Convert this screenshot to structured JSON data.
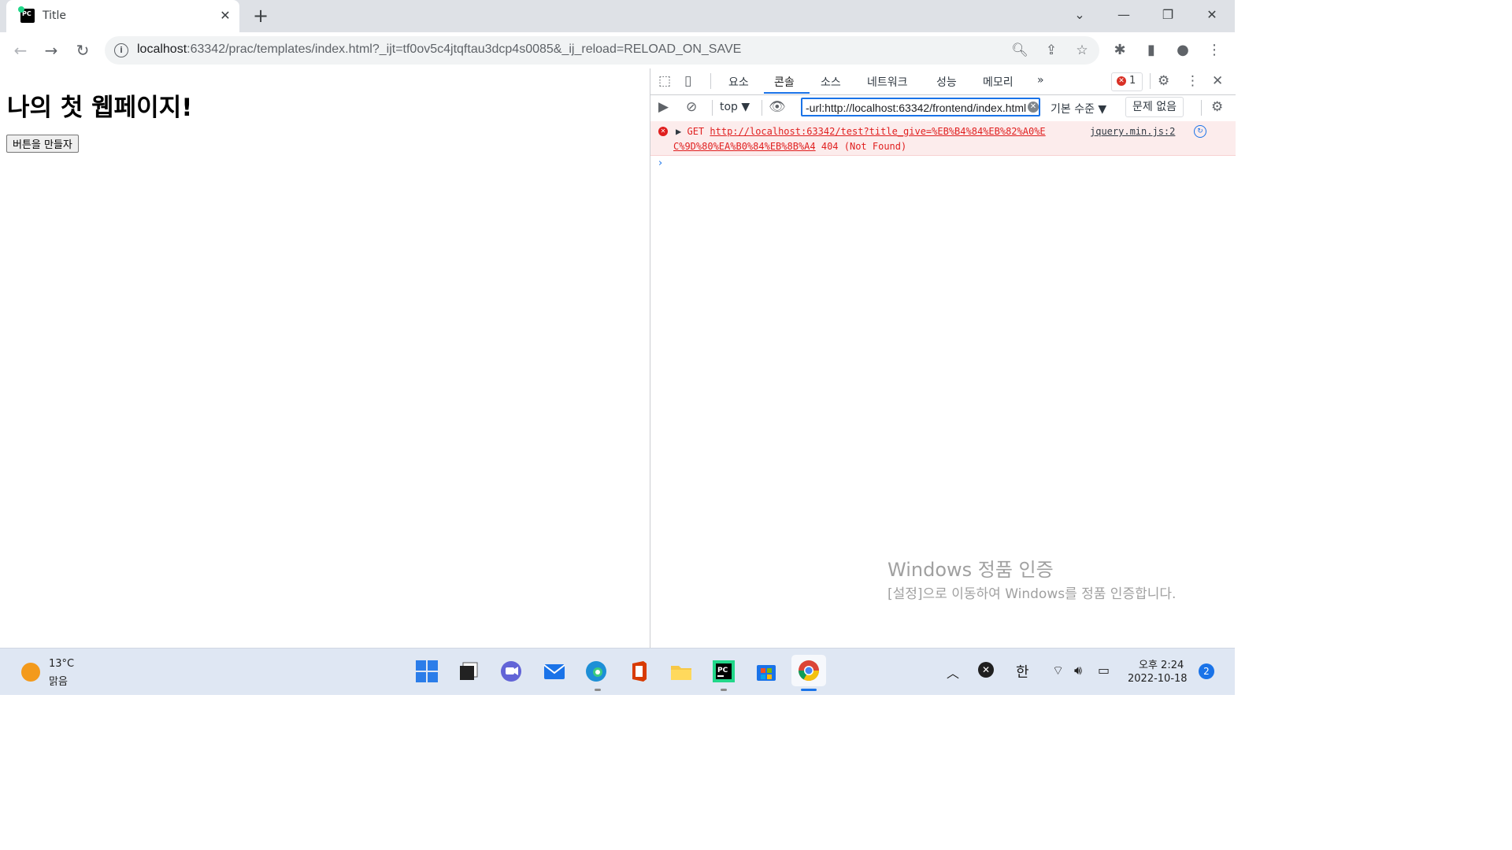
{
  "browser": {
    "tab_title": "Title",
    "tab_favicon_text": "PC",
    "url_host": "localhost",
    "url_rest": ":63342/prac/templates/index.html?_ijt=tf0ov5c4jtqftau3dcp4s0085&_ij_reload=RELOAD_ON_SAVE"
  },
  "page": {
    "heading": "나의 첫 웹페이지!",
    "button_label": "버튼을 만들자"
  },
  "devtools": {
    "tabs": [
      "요소",
      "콘솔",
      "소스",
      "네트워크",
      "성능",
      "메모리"
    ],
    "active_tab": "콘솔",
    "more_tabs": "»",
    "error_count": "1",
    "context": "top ▼",
    "filter_value": "-url:http://localhost:63342/frontend/index.html",
    "levels": "기본 수준 ▼",
    "issues": "문제 없음",
    "console_error": {
      "method": "GET",
      "url_line1": "http://localhost:63342/test?title_give=%EB%B4%84%EB%82%A0%E",
      "url_line2": "C%9D%80%EA%B0%84%EB%8B%A4",
      "status": "404 (Not Found)",
      "source": "jquery.min.js:2"
    },
    "prompt": "›"
  },
  "watermark": {
    "title": "Windows 정품 인증",
    "subtitle": "[설정]으로 이동하여 Windows를 정품 인증합니다."
  },
  "taskbar": {
    "weather_temp": "13°C",
    "weather_desc": "맑음",
    "ime": "한",
    "time": "오후 2:24",
    "date": "2022-10-18",
    "notifications": "2"
  },
  "colors": {
    "accent": "#1a73e8",
    "error": "#e01f1f",
    "error_bg": "#fcecec"
  }
}
